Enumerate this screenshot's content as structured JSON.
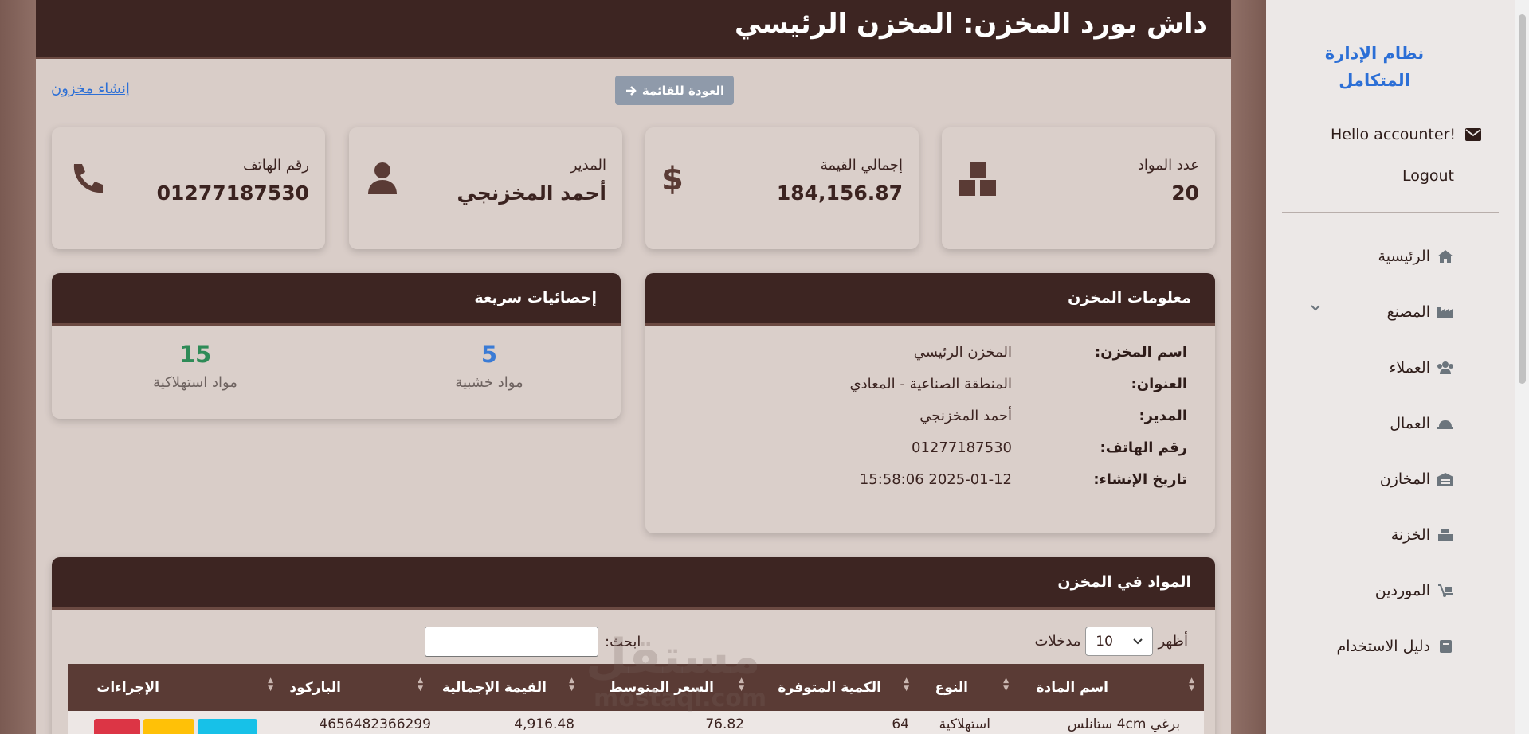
{
  "header": {
    "title": "داش بورد المخزن: المخزن الرئيسي"
  },
  "actions": {
    "back_label": "العودة للقائمة",
    "create_label": "إنشاء مخزون"
  },
  "cards": [
    {
      "label": "عدد المواد",
      "value": "20",
      "icon": "boxes-icon"
    },
    {
      "label": "إجمالي القيمة",
      "value": "184,156.87",
      "icon": "dollar-icon"
    },
    {
      "label": "المدير",
      "value": "أحمد المخزنجي",
      "icon": "user-icon"
    },
    {
      "label": "رقم الهاتف",
      "value": "01277187530",
      "icon": "phone-icon"
    }
  ],
  "info_panel": {
    "title": "معلومات المخزن",
    "rows": [
      {
        "key": "اسم المخزن:",
        "value": "المخزن الرئيسي"
      },
      {
        "key": "العنوان:",
        "value": "المنطقة الصناعية - المعادي"
      },
      {
        "key": "المدير:",
        "value": "أحمد المخزنجي"
      },
      {
        "key": "رقم الهاتف:",
        "value": "01277187530"
      },
      {
        "key": "تاريخ الإنشاء:",
        "value": "2025-01-12 15:58:06"
      }
    ]
  },
  "stats_panel": {
    "title": "إحصائيات سريعة",
    "wood": {
      "count": "5",
      "label": "مواد خشبية",
      "color": "#3a7bd5"
    },
    "consumable": {
      "count": "15",
      "label": "مواد استهلاكية",
      "color": "#2e8b57"
    }
  },
  "materials": {
    "title": "المواد في المخزن",
    "show_label": "أظهر",
    "entries_label": "مدخلات",
    "page_size": "10",
    "search_label": "ابحث:",
    "search_value": "",
    "columns": [
      "اسم المادة",
      "النوع",
      "الكمية المتوفرة",
      "السعر المتوسط",
      "القيمة الإجمالية",
      "الباركود",
      "الإجراءات"
    ],
    "rows": [
      {
        "name": "برغي 4cm ستانلس",
        "type": "استهلاكية",
        "qty": "64",
        "avg": "76.82",
        "total": "4,916.48",
        "barcode": "4656482366299"
      }
    ]
  },
  "sidebar": {
    "brand": "نظام الإدارة المتكامل",
    "hello": "Hello accounter!",
    "logout": "Logout",
    "items": [
      {
        "label": "الرئيسية",
        "icon": "home-icon"
      },
      {
        "label": "المصنع",
        "icon": "industry-icon"
      },
      {
        "label": "العملاء",
        "icon": "users-icon"
      },
      {
        "label": "العمال",
        "icon": "hardhat-icon"
      },
      {
        "label": "المخازن",
        "icon": "warehouse-icon"
      },
      {
        "label": "الخزنة",
        "icon": "cash-register-icon"
      },
      {
        "label": "الموردين",
        "icon": "dolly-icon"
      },
      {
        "label": "دليل الاستخدام",
        "icon": "book-icon"
      }
    ]
  },
  "watermark": {
    "text": "مستقل",
    "url_text": "mostaql.com"
  }
}
